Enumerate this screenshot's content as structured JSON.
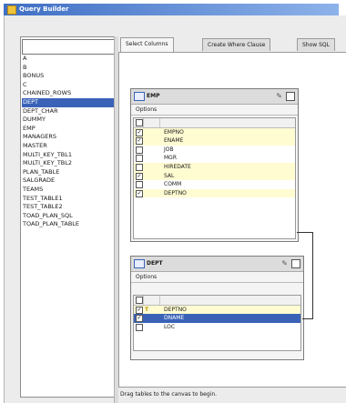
{
  "window": {
    "title": "Query Builder"
  },
  "search": {
    "value": ""
  },
  "tables": [
    {
      "name": "A",
      "selected": false
    },
    {
      "name": "B",
      "selected": false
    },
    {
      "name": "BONUS",
      "selected": false
    },
    {
      "name": "C",
      "selected": false
    },
    {
      "name": "CHAINED_ROWS",
      "selected": false
    },
    {
      "name": "DEPT",
      "selected": true
    },
    {
      "name": "DEPT_CHAR",
      "selected": false
    },
    {
      "name": "DUMMY",
      "selected": false
    },
    {
      "name": "EMP",
      "selected": false
    },
    {
      "name": "MANAGERS",
      "selected": false
    },
    {
      "name": "MASTER",
      "selected": false
    },
    {
      "name": "MULTI_KEY_TBL1",
      "selected": false
    },
    {
      "name": "MULTI_KEY_TBL2",
      "selected": false
    },
    {
      "name": "PLAN_TABLE",
      "selected": false
    },
    {
      "name": "SALGRADE",
      "selected": false
    },
    {
      "name": "TEAMS",
      "selected": false
    },
    {
      "name": "TEST_TABLE1",
      "selected": false
    },
    {
      "name": "TEST_TABLE2",
      "selected": false
    },
    {
      "name": "TOAD_PLAN_SQL",
      "selected": false
    },
    {
      "name": "TOAD_PLAN_TABLE",
      "selected": false
    }
  ],
  "tabs": [
    {
      "label": "Select Columns",
      "active": true
    },
    {
      "label": "Create Where Clause",
      "active": false
    },
    {
      "label": "Show SQL",
      "active": false
    }
  ],
  "emp_table": {
    "name": "EMP",
    "options_label": "Options",
    "columns": [
      {
        "name": "EMPNO",
        "checked": true,
        "highlight": "yellow"
      },
      {
        "name": "ENAME",
        "checked": true,
        "highlight": "yellow"
      },
      {
        "name": "JOB",
        "checked": false,
        "highlight": "none"
      },
      {
        "name": "MGR",
        "checked": false,
        "highlight": "none"
      },
      {
        "name": "HIREDATE",
        "checked": false,
        "highlight": "yellow"
      },
      {
        "name": "SAL",
        "checked": true,
        "highlight": "yellow"
      },
      {
        "name": "COMM",
        "checked": false,
        "highlight": "none"
      },
      {
        "name": "DEPTNO",
        "checked": true,
        "highlight": "yellow"
      }
    ]
  },
  "dept_table": {
    "name": "DEPT",
    "options_label": "Options",
    "columns": [
      {
        "name": "DEPTNO",
        "checked": true,
        "highlight": "yellow",
        "key": true
      },
      {
        "name": "DNAME",
        "checked": true,
        "highlight": "blue",
        "key": false
      },
      {
        "name": "LOC",
        "checked": false,
        "highlight": "none",
        "key": false
      }
    ]
  },
  "status": {
    "text": "Drag tables to the canvas to begin."
  },
  "icons": {
    "table": "table-icon",
    "pin": "pin-icon",
    "maximize": "maximize-icon",
    "key": "key-icon"
  }
}
